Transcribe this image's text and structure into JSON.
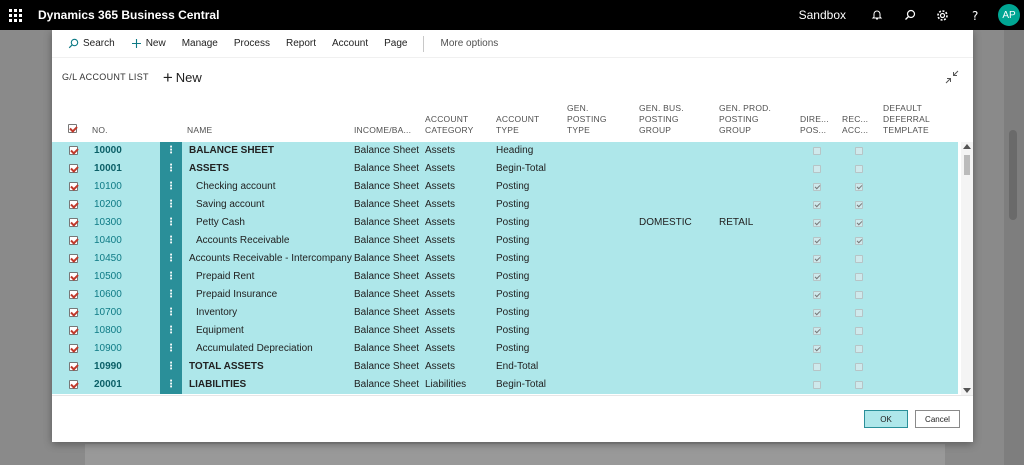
{
  "topbar": {
    "app_title": "Dynamics 365 Business Central",
    "environment": "Sandbox",
    "avatar_initials": "AP",
    "icons": [
      "bell-icon",
      "search-icon",
      "gear-icon",
      "help-icon"
    ]
  },
  "actions": {
    "search": "Search",
    "new": "New",
    "manage": "Manage",
    "process": "Process",
    "report": "Report",
    "account": "Account",
    "page": "Page",
    "more_options": "More options"
  },
  "page": {
    "title": "G/L ACCOUNT LIST",
    "new_label": "New"
  },
  "columns": {
    "no": "NO.",
    "name": "NAME",
    "income_balance": "INCOME/BA...",
    "account_category": [
      "ACCOUNT",
      "CATEGORY"
    ],
    "account_type": [
      "ACCOUNT",
      "TYPE"
    ],
    "gen_posting_type": [
      "GEN.",
      "POSTING",
      "TYPE"
    ],
    "gen_bus_posting_group": [
      "GEN. BUS.",
      "POSTING",
      "GROUP"
    ],
    "gen_prod_posting_group": [
      "GEN. PROD.",
      "POSTING",
      "GROUP"
    ],
    "direct_posting": [
      "DIRE...",
      "POS..."
    ],
    "reconciliation": [
      "REC...",
      "ACC..."
    ],
    "default_deferral": [
      "DEFAULT",
      "DEFERRAL",
      "TEMPLATE"
    ]
  },
  "rows": [
    {
      "no": "10000",
      "name": "BALANCE SHEET",
      "bold": true,
      "indent": 0,
      "income_balance": "Balance Sheet",
      "category": "Assets",
      "type": "Heading",
      "gen_bus": "",
      "gen_prod": "",
      "direct": false,
      "recon": false
    },
    {
      "no": "10001",
      "name": "ASSETS",
      "bold": true,
      "indent": 0,
      "income_balance": "Balance Sheet",
      "category": "Assets",
      "type": "Begin-Total",
      "gen_bus": "",
      "gen_prod": "",
      "direct": false,
      "recon": false
    },
    {
      "no": "10100",
      "name": "Checking account",
      "bold": false,
      "indent": 1,
      "income_balance": "Balance Sheet",
      "category": "Assets",
      "type": "Posting",
      "gen_bus": "",
      "gen_prod": "",
      "direct": true,
      "recon": true
    },
    {
      "no": "10200",
      "name": "Saving account",
      "bold": false,
      "indent": 1,
      "income_balance": "Balance Sheet",
      "category": "Assets",
      "type": "Posting",
      "gen_bus": "",
      "gen_prod": "",
      "direct": true,
      "recon": true
    },
    {
      "no": "10300",
      "name": "Petty Cash",
      "bold": false,
      "indent": 1,
      "income_balance": "Balance Sheet",
      "category": "Assets",
      "type": "Posting",
      "gen_bus": "DOMESTIC",
      "gen_prod": "RETAIL",
      "direct": true,
      "recon": true
    },
    {
      "no": "10400",
      "name": "Accounts Receivable",
      "bold": false,
      "indent": 1,
      "income_balance": "Balance Sheet",
      "category": "Assets",
      "type": "Posting",
      "gen_bus": "",
      "gen_prod": "",
      "direct": true,
      "recon": true
    },
    {
      "no": "10450",
      "name": "Accounts Receivable - Intercompany",
      "bold": false,
      "indent": 0,
      "income_balance": "Balance Sheet",
      "category": "Assets",
      "type": "Posting",
      "gen_bus": "",
      "gen_prod": "",
      "direct": true,
      "recon": false
    },
    {
      "no": "10500",
      "name": "Prepaid Rent",
      "bold": false,
      "indent": 1,
      "income_balance": "Balance Sheet",
      "category": "Assets",
      "type": "Posting",
      "gen_bus": "",
      "gen_prod": "",
      "direct": true,
      "recon": false
    },
    {
      "no": "10600",
      "name": "Prepaid Insurance",
      "bold": false,
      "indent": 1,
      "income_balance": "Balance Sheet",
      "category": "Assets",
      "type": "Posting",
      "gen_bus": "",
      "gen_prod": "",
      "direct": true,
      "recon": false
    },
    {
      "no": "10700",
      "name": "Inventory",
      "bold": false,
      "indent": 1,
      "income_balance": "Balance Sheet",
      "category": "Assets",
      "type": "Posting",
      "gen_bus": "",
      "gen_prod": "",
      "direct": true,
      "recon": false
    },
    {
      "no": "10800",
      "name": "Equipment",
      "bold": false,
      "indent": 1,
      "income_balance": "Balance Sheet",
      "category": "Assets",
      "type": "Posting",
      "gen_bus": "",
      "gen_prod": "",
      "direct": true,
      "recon": false
    },
    {
      "no": "10900",
      "name": "Accumulated Depreciation",
      "bold": false,
      "indent": 1,
      "income_balance": "Balance Sheet",
      "category": "Assets",
      "type": "Posting",
      "gen_bus": "",
      "gen_prod": "",
      "direct": true,
      "recon": false
    },
    {
      "no": "10990",
      "name": "TOTAL ASSETS",
      "bold": true,
      "indent": 0,
      "income_balance": "Balance Sheet",
      "category": "Assets",
      "type": "End-Total",
      "gen_bus": "",
      "gen_prod": "",
      "direct": false,
      "recon": false
    },
    {
      "no": "20001",
      "name": "LIABILITIES",
      "bold": true,
      "indent": 0,
      "income_balance": "Balance Sheet",
      "category": "Liabilities",
      "type": "Begin-Total",
      "gen_bus": "",
      "gen_prod": "",
      "direct": false,
      "recon": false
    }
  ],
  "footer": {
    "ok": "OK",
    "cancel": "Cancel"
  }
}
